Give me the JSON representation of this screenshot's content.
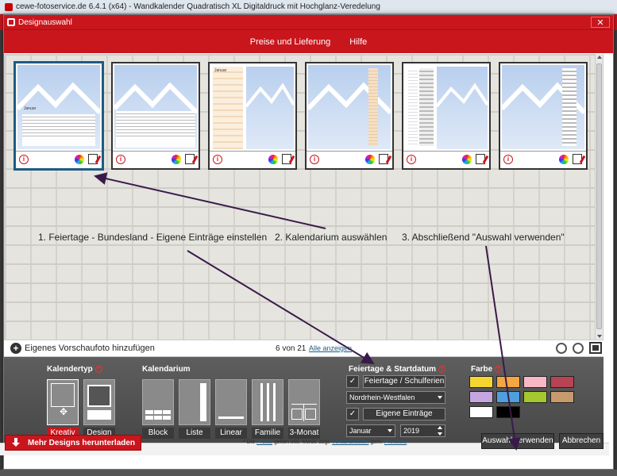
{
  "outer_window": {
    "title": "cewe-fotoservice.de 6.4.1 (x64) - Wandkalender Quadratisch XL Digitaldruck mit Hochglanz-Veredelung"
  },
  "dialog": {
    "title": "Designauswahl",
    "close_label": "✕",
    "nav": [
      "Preise und Lieferung",
      "Hilfe"
    ]
  },
  "thumbnails": [
    {
      "variant": "calendar-grid",
      "month": "Januar",
      "selected": true
    },
    {
      "variant": "calendar-grid-wide",
      "month": "",
      "selected": false
    },
    {
      "variant": "side-list-orange",
      "month": "Januar",
      "selected": false
    },
    {
      "variant": "side-list-right",
      "month": "",
      "selected": false
    },
    {
      "variant": "side-list-left",
      "month": "",
      "selected": false
    },
    {
      "variant": "side-list-right-2",
      "month": "",
      "selected": false
    }
  ],
  "annotations": {
    "step1": "1. Feiertage - Bundesland - Eigene Einträge einstellen",
    "step2": "2. Kalendarium auswählen",
    "step3": "3. Abschließend \"Auswahl verwenden\""
  },
  "photo_bar": {
    "add_photo": "Eigenes Vorschaufoto hinzufügen",
    "count": "6 von 21",
    "show_all": "Alle anzeigen"
  },
  "kalendertyp": {
    "label": "Kalendertyp",
    "options": [
      "Kreativ",
      "Design"
    ],
    "active": "Kreativ"
  },
  "kalendarium": {
    "label": "Kalendarium",
    "options": [
      "Block",
      "Liste",
      "Linear",
      "Familie",
      "3-Monat"
    ]
  },
  "feiertage": {
    "label": "Feiertage & Startdatum",
    "holidays_button": "Feiertage / Schulferien",
    "state": "Nordrhein-Westfalen",
    "own_entries": "Eigene Einträge",
    "month": "Januar",
    "year": "2019",
    "check": "✓"
  },
  "farbe": {
    "label": "Farbe",
    "swatches": [
      "#f7d531",
      "#f5a641",
      "#f7b8c4",
      "#b84453",
      "#c6a6e0",
      "#4f9fe0",
      "#a4c82e",
      "#c79a6e",
      "#ffffff",
      "#000000"
    ]
  },
  "footer": {
    "download_label": "Mehr Designs herunterladen",
    "note_prefix": "* Die",
    "note_preise": "Preise",
    "note_mid": "gelten inkl. MwSt. zzgl.",
    "note_versand": "Versandkosten",
    "note_gem": "gem.",
    "note_preisliste": "Preisliste",
    "use_button": "Auswahl verwenden",
    "cancel_button": "Abbrechen"
  },
  "colors": {
    "brand_red": "#c9161d",
    "panel_dark": "#4c4c4c",
    "selection_blue": "#1d5b83"
  }
}
